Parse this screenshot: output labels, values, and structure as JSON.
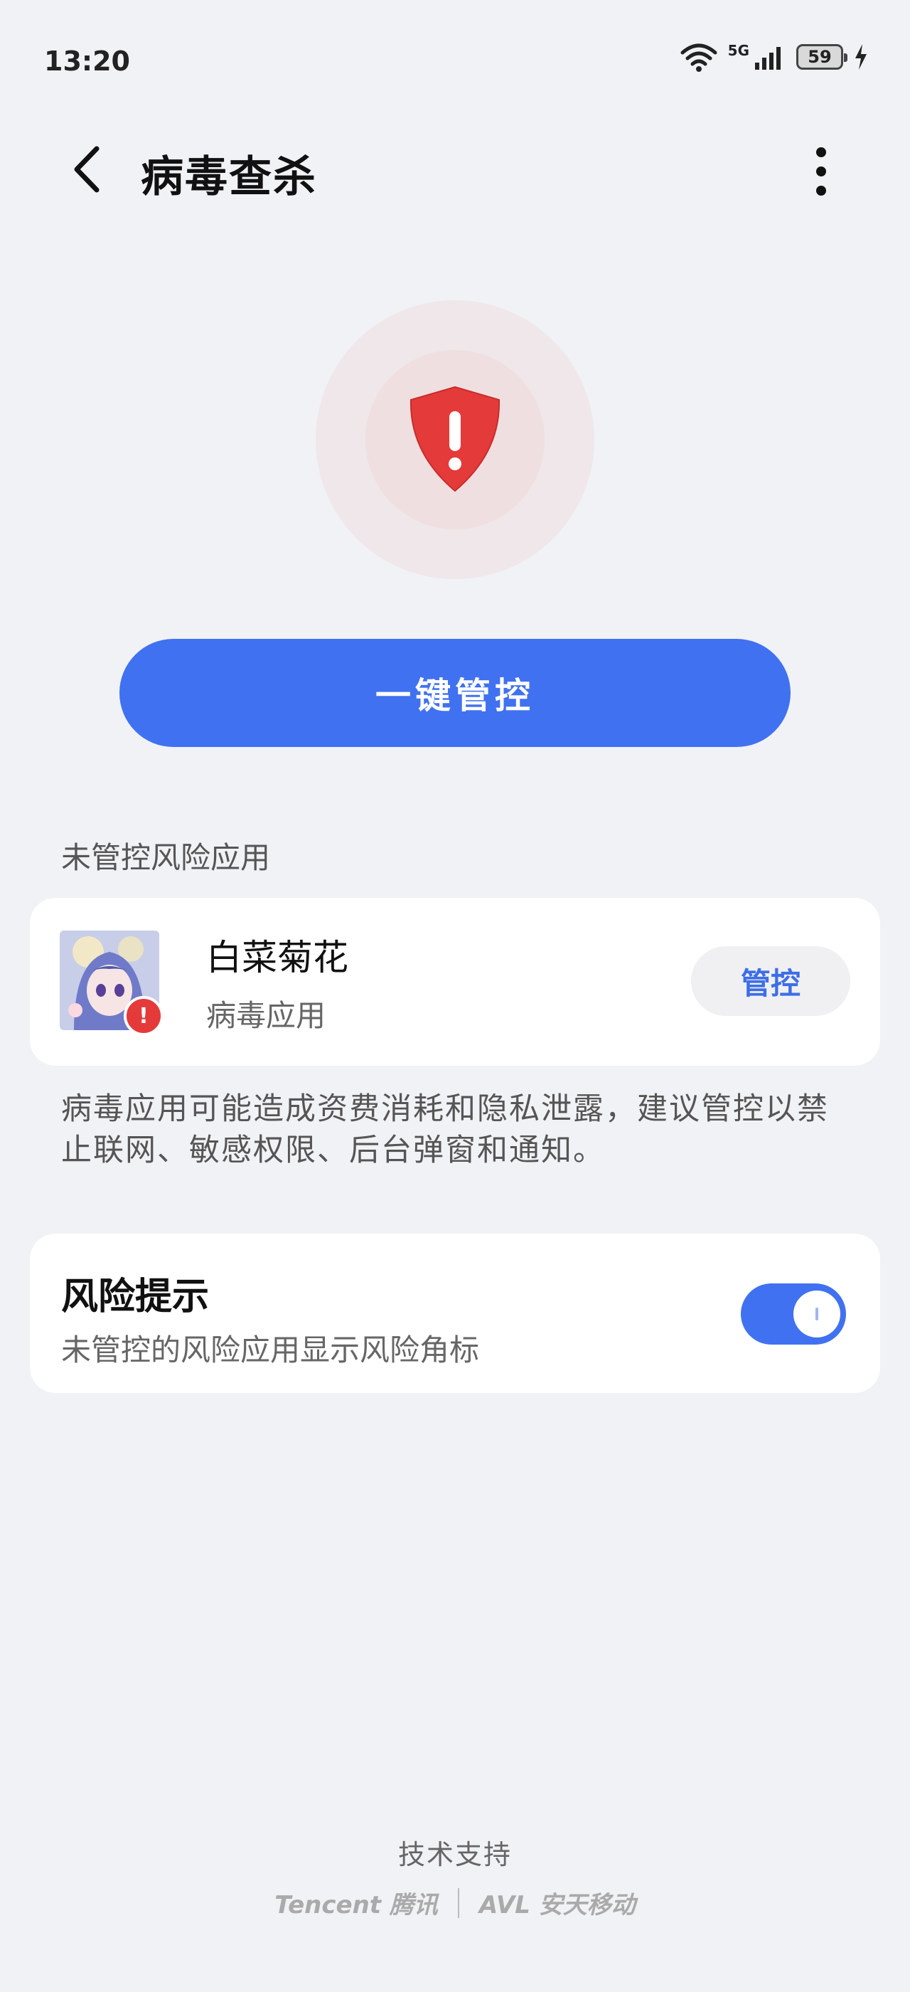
{
  "status_bar": {
    "time": "13:20",
    "network": "5G",
    "battery": "59"
  },
  "header": {
    "title": "病毒查杀"
  },
  "hero": {
    "icon": "shield-alert-icon",
    "accent_color": "#e53a3a"
  },
  "primary_action": {
    "label": "一键管控",
    "color": "#4071f0"
  },
  "section": {
    "label": "未管控风险应用"
  },
  "apps": [
    {
      "name": "白菜菊花",
      "type": "病毒应用",
      "action_label": "管控"
    }
  ],
  "warning": {
    "text": "病毒应用可能造成资费消耗和隐私泄露，建议管控以禁止联网、敏感权限、后台弹窗和通知。"
  },
  "risk_setting": {
    "title": "风险提示",
    "description": "未管控的风险应用显示风险角标",
    "enabled": true
  },
  "footer": {
    "label": "技术支持",
    "logo_left": "Tencent 腾讯",
    "logo_right": "AVL 安天移动"
  }
}
